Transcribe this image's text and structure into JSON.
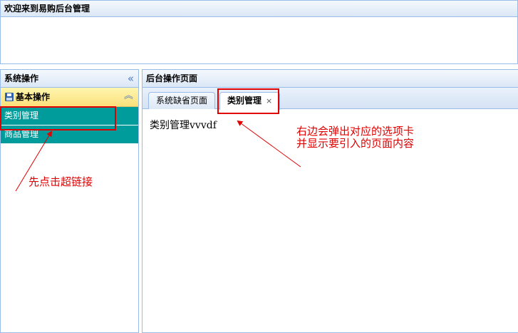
{
  "banner": {
    "title": "欢迎来到易购后台管理"
  },
  "west": {
    "title": "系统操作",
    "collapse_icon": "double-chevron-left-icon",
    "accordion": {
      "title": "基本操作",
      "icon": "save-icon",
      "toggle_icon": "double-chevron-up-icon",
      "items": [
        {
          "label": "类别管理"
        },
        {
          "label": "商品管理"
        }
      ]
    }
  },
  "center": {
    "title": "后台操作页面",
    "tabs": [
      {
        "label": "系统缺省页面"
      },
      {
        "label": "类别管理",
        "close": "×"
      }
    ],
    "content": "类别管理vvvdf"
  },
  "annotations": {
    "left_note": "先点击超链接",
    "right_note_line1": "右边会弹出对应的选项卡",
    "right_note_line2": "并显示要引入的页面内容"
  },
  "colors": {
    "nav_item_bg": "#009b9b",
    "accordion_header": "#fbe07a",
    "annotation": "#e00000",
    "border": "#99bbe8"
  }
}
